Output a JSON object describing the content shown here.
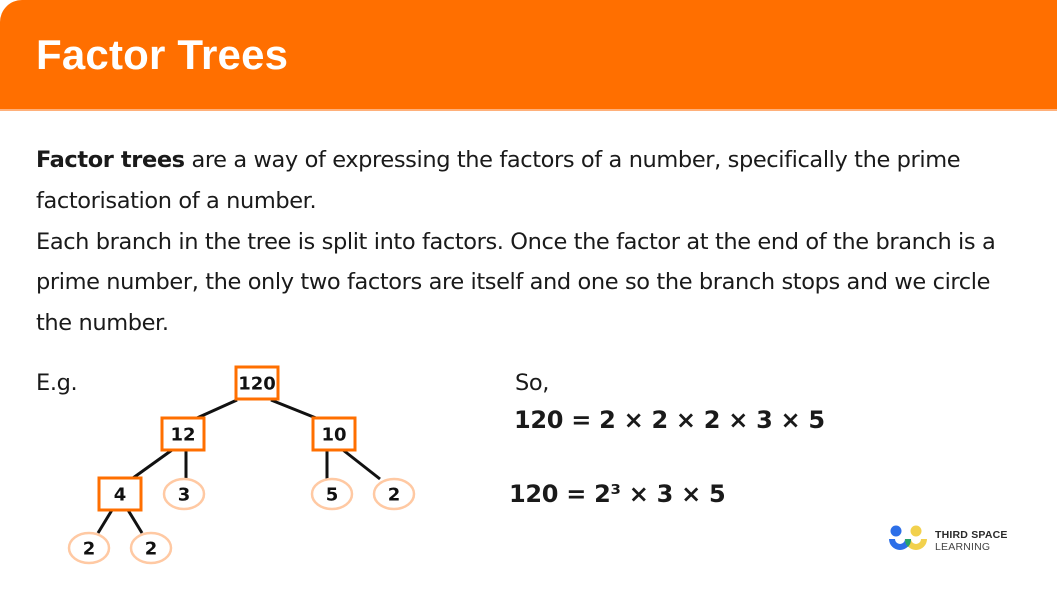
{
  "header": {
    "title": "Factor Trees",
    "color": "#ff6f00"
  },
  "intro": {
    "term": "Factor trees",
    "definition_rest": " are a way of expressing the factors of a number, specifically the prime factorisation of a number.",
    "explanation": "Each branch in the tree is split into factors. Once the factor at the end of the branch is a prime number, the only two factors are itself and one so the branch stops and we circle the number."
  },
  "example": {
    "label": "E.g.",
    "tree": {
      "nodes": [
        {
          "id": "n120",
          "value": "120",
          "type": "composite"
        },
        {
          "id": "n12",
          "value": "12",
          "type": "composite"
        },
        {
          "id": "n10",
          "value": "10",
          "type": "composite"
        },
        {
          "id": "n4",
          "value": "4",
          "type": "composite"
        },
        {
          "id": "n3",
          "value": "3",
          "type": "prime"
        },
        {
          "id": "n5",
          "value": "5",
          "type": "prime"
        },
        {
          "id": "n2a",
          "value": "2",
          "type": "prime"
        },
        {
          "id": "n2b",
          "value": "2",
          "type": "prime"
        },
        {
          "id": "n2c",
          "value": "2",
          "type": "prime"
        }
      ],
      "edges": [
        [
          "n120",
          "n12"
        ],
        [
          "n120",
          "n10"
        ],
        [
          "n12",
          "n4"
        ],
        [
          "n12",
          "n3"
        ],
        [
          "n10",
          "n5"
        ],
        [
          "n10",
          "n2a"
        ],
        [
          "n4",
          "n2b"
        ],
        [
          "n4",
          "n2c"
        ]
      ],
      "composite_box_color": "#ff6f00",
      "prime_circle_color": "#ffc9a3"
    }
  },
  "result": {
    "lead": "So,",
    "equation_expanded": "120 = 2 × 2 × 2 × 3 × 5",
    "equation_index_form": "120 = 2³ × 3 × 5"
  },
  "brand": {
    "line1": "THIRD SPACE",
    "line2": "LEARNING",
    "colors": {
      "blue": "#2d6fe8",
      "green": "#27a36b",
      "yellow": "#f2d14d"
    }
  }
}
